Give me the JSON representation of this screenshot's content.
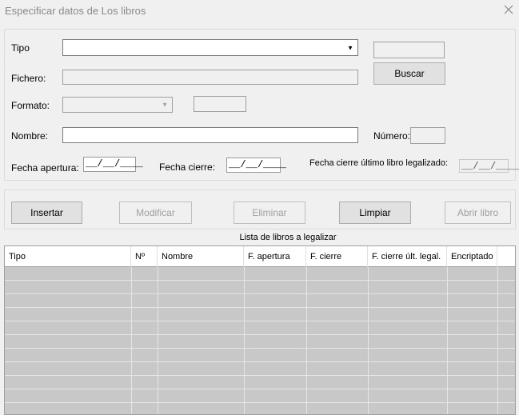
{
  "window": {
    "title": "Especificar datos de Los libros"
  },
  "form": {
    "tipo_label": "Tipo",
    "tipo_value": "",
    "fichero_label": "Fichero:",
    "fichero_value": "",
    "buscar_label": "Buscar",
    "formato_label": "Formato:",
    "formato_value": "",
    "nombre_label": "Nombre:",
    "nombre_value": "",
    "numero_label": "Número:",
    "numero_value": "",
    "fecha_apertura_label": "Fecha apertura:",
    "fecha_apertura_value": "__/__/____",
    "fecha_cierre_label": "Fecha cierre:",
    "fecha_cierre_value": "__/__/____",
    "fecha_ult_label": "Fecha cierre último libro legalizado:",
    "fecha_ult_value": "__/__/____"
  },
  "actions": {
    "insertar": "Insertar",
    "modificar": "Modificar",
    "eliminar": "Eliminar",
    "limpiar": "Limpiar",
    "abrir_libro": "Abrir libro"
  },
  "grid": {
    "caption": "Lista de libros a legalizar",
    "columns": [
      "Tipo",
      "Nº",
      "Nombre",
      "F. apertura",
      "F. cierre",
      "F. cierre  últ. legal.",
      "Encriptado"
    ],
    "rows": []
  },
  "icons": {
    "close": "close-icon",
    "dropdown": "chevron-down-icon"
  },
  "colors": {
    "background": "#f0f0f0",
    "grid_empty": "#c8c8c8",
    "disabled_text": "#a0a0a0"
  }
}
